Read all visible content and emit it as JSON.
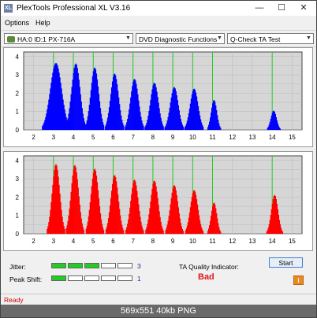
{
  "window": {
    "title": "PlexTools Professional XL V3.16",
    "icon_text": "XL",
    "minimize": "—",
    "maximize": "☐",
    "close": "✕"
  },
  "menu": {
    "options": "Options",
    "help": "Help"
  },
  "toolbar": {
    "drive": "HA:0 ID:1  PX-716A",
    "function": "DVD Diagnostic Functions",
    "test": "Q-Check TA Test"
  },
  "chart_data": [
    {
      "type": "bar",
      "color": "#0000ff",
      "x_ticks": [
        "2",
        "3",
        "4",
        "5",
        "6",
        "7",
        "8",
        "9",
        "10",
        "11",
        "12",
        "13",
        "14",
        "15"
      ],
      "y_ticks": [
        "0",
        "0.5",
        "1",
        "1.5",
        "2",
        "2.5",
        "3",
        "3.5",
        "4"
      ],
      "xlim": [
        1.5,
        15.5
      ],
      "ylim": [
        0,
        4.25
      ],
      "green_lines": [
        3,
        4,
        5,
        6,
        7,
        8,
        9,
        10,
        11,
        14
      ],
      "peaks": [
        {
          "x": 3.1,
          "h": 3.65,
          "hw": 0.6
        },
        {
          "x": 4.1,
          "h": 3.62,
          "hw": 0.45
        },
        {
          "x": 5.05,
          "h": 3.4,
          "hw": 0.42
        },
        {
          "x": 6.05,
          "h": 3.07,
          "hw": 0.42
        },
        {
          "x": 7.05,
          "h": 2.78,
          "hw": 0.42
        },
        {
          "x": 8.05,
          "h": 2.57,
          "hw": 0.42
        },
        {
          "x": 9.05,
          "h": 2.33,
          "hw": 0.42
        },
        {
          "x": 10.05,
          "h": 2.25,
          "hw": 0.42
        },
        {
          "x": 11.05,
          "h": 1.63,
          "hw": 0.3
        },
        {
          "x": 14.05,
          "h": 1.05,
          "hw": 0.3
        }
      ]
    },
    {
      "type": "bar",
      "color": "#ff0000",
      "x_ticks": [
        "2",
        "3",
        "4",
        "5",
        "6",
        "7",
        "8",
        "9",
        "10",
        "11",
        "12",
        "13",
        "14",
        "15"
      ],
      "y_ticks": [
        "0",
        "0.5",
        "1",
        "1.5",
        "2",
        "2.5",
        "3",
        "3.5",
        "4"
      ],
      "xlim": [
        1.5,
        15.5
      ],
      "ylim": [
        0,
        4.25
      ],
      "green_lines": [
        3,
        4,
        5,
        6,
        7,
        8,
        9,
        10,
        11,
        14
      ],
      "peaks": [
        {
          "x": 3.1,
          "h": 3.8,
          "hw": 0.4
        },
        {
          "x": 4.05,
          "h": 3.75,
          "hw": 0.4
        },
        {
          "x": 5.05,
          "h": 3.55,
          "hw": 0.4
        },
        {
          "x": 6.05,
          "h": 3.2,
          "hw": 0.4
        },
        {
          "x": 7.05,
          "h": 2.95,
          "hw": 0.4
        },
        {
          "x": 8.05,
          "h": 2.9,
          "hw": 0.4
        },
        {
          "x": 9.05,
          "h": 2.65,
          "hw": 0.4
        },
        {
          "x": 10.05,
          "h": 2.38,
          "hw": 0.4
        },
        {
          "x": 11.05,
          "h": 1.7,
          "hw": 0.3
        },
        {
          "x": 14.1,
          "h": 2.12,
          "hw": 0.35
        }
      ]
    }
  ],
  "metrics": {
    "jitter_label": "Jitter:",
    "jitter_value": "3",
    "jitter_level": 3,
    "peak_label": "Peak Shift:",
    "peak_value": "1",
    "peak_level": 1,
    "segments": 5,
    "ta_label": "TA Quality Indicator:",
    "ta_result": "Bad"
  },
  "buttons": {
    "start": "Start",
    "info": "i"
  },
  "status": {
    "text": "Ready"
  },
  "caption": "569x551  40kb  PNG"
}
